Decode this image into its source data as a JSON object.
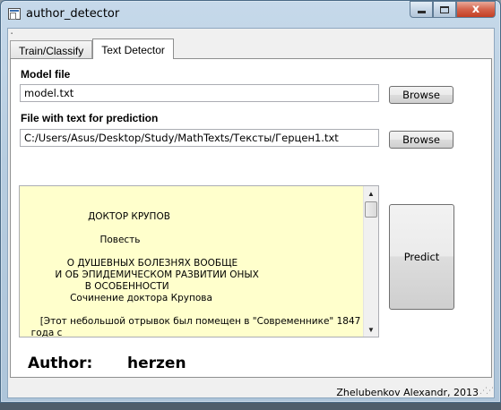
{
  "window": {
    "title": "author_detector",
    "controls": {
      "minimize": "",
      "maximize": "",
      "close": "x"
    }
  },
  "tabs": [
    {
      "label": "Train/Classify",
      "active": false
    },
    {
      "label": "Text Detector",
      "active": true
    }
  ],
  "model": {
    "label": "Model file",
    "value": "model.txt",
    "browse_label": "Browse"
  },
  "text_file": {
    "label": "File with text for prediction",
    "value": "C:/Users/Asus/Desktop/Study/MathTexts/Тексты/Герцен1.txt",
    "browse_label": "Browse"
  },
  "text_preview": {
    "content": "\n\n                     ДОКТОР КРУПОВ\n\n                         Повесть\n\n              О ДУШЕВНЫХ БОЛЕЗНЯХ ВООБЩЕ\n          И ОБ ЭПИДЕМИЧЕСКОМ РАЗВИТИИ ОНЫХ\n                    В ОСОБЕННОСТИ\n               Сочинение доктора Крупова\n\n     [Этот небольшой отрывок был помещен в \"Современнике\" 1847\n  года с",
    "background": "#ffffcc"
  },
  "predict_label": "Predict",
  "result": {
    "author_label": "Author:",
    "author_value": "herzen"
  },
  "credit": "Zhelubenkov Alexandr, 2013"
}
